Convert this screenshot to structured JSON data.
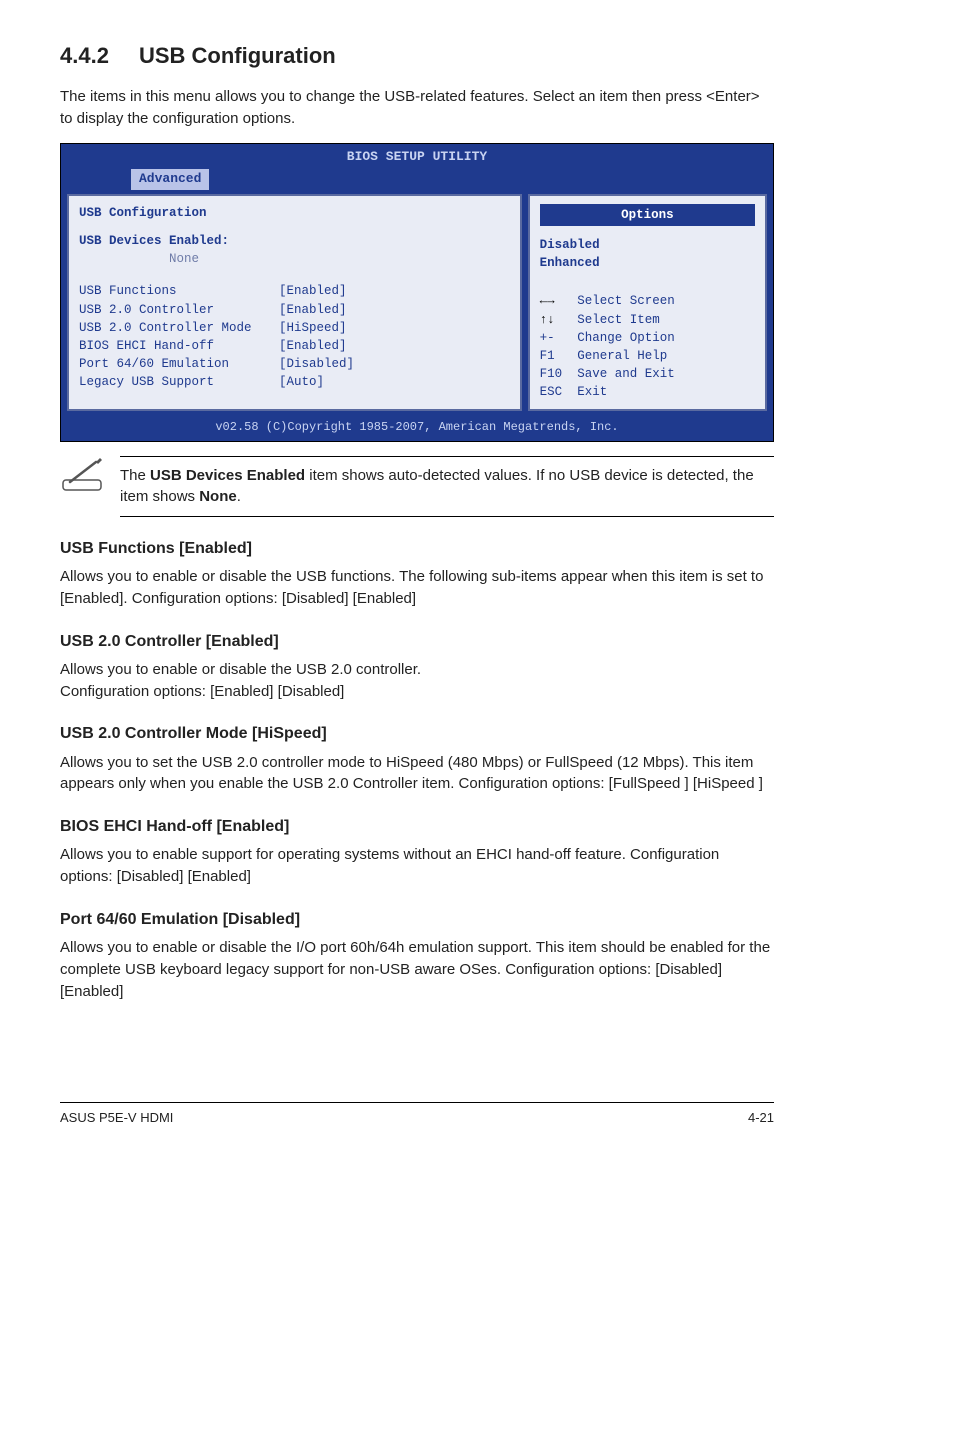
{
  "section": {
    "num": "4.4.2",
    "title": "USB Configuration"
  },
  "intro": "The items in this menu allows you to change the USB-related features. Select an item then press <Enter> to display the configuration options.",
  "bios": {
    "utility_title": "BIOS SETUP UTILITY",
    "tab": "Advanced",
    "left": {
      "heading": "USB Configuration",
      "devices_label": "USB Devices Enabled:",
      "devices_value": "None",
      "rows": [
        {
          "label": "USB Functions",
          "value": "[Enabled]"
        },
        {
          "label": "USB 2.0 Controller",
          "value": "[Enabled]"
        },
        {
          "label": "USB 2.0 Controller Mode",
          "value": "[HiSpeed]"
        },
        {
          "label": "BIOS EHCI Hand-off",
          "value": "[Enabled]"
        },
        {
          "label": "Port 64/60 Emulation",
          "value": "[Disabled]"
        },
        {
          "label": "Legacy USB Support",
          "value": "[Auto]"
        }
      ]
    },
    "right": {
      "options_title": "Options",
      "opt1": "Disabled",
      "opt2": "Enhanced",
      "help": [
        {
          "key": "←→",
          "txt": "Select Screen"
        },
        {
          "key": "↑↓",
          "txt": "Select Item"
        },
        {
          "key": "+-",
          "txt": "Change Option"
        },
        {
          "key": "F1",
          "txt": "General Help"
        },
        {
          "key": "F10",
          "txt": "Save and Exit"
        },
        {
          "key": "ESC",
          "txt": "Exit"
        }
      ]
    },
    "footer": "v02.58 (C)Copyright 1985-2007, American Megatrends, Inc."
  },
  "note": {
    "pre": "The ",
    "bold1": "USB Devices Enabled",
    "mid": " item shows auto-detected values. If no USB device is detected, the item shows ",
    "bold2": "None",
    "post": "."
  },
  "subs": {
    "s1": {
      "h": "USB Functions [Enabled]",
      "p": "Allows you to enable or disable the USB functions. The following sub-items appear when this item is set to [Enabled]. Configuration options: [Disabled] [Enabled]"
    },
    "s2": {
      "h": "USB 2.0 Controller [Enabled]",
      "p1": "Allows you to enable or disable the USB 2.0 controller.",
      "p2": "Configuration options: [Enabled] [Disabled]"
    },
    "s3": {
      "h": "USB 2.0 Controller Mode [HiSpeed]",
      "p": "Allows you to set the USB 2.0 controller mode to HiSpeed (480 Mbps) or FullSpeed (12 Mbps). This item appears only when you enable the USB 2.0 Controller item. Configuration options: [FullSpeed ] [HiSpeed ]"
    },
    "s4": {
      "h": "BIOS EHCI Hand-off [Enabled]",
      "p": "Allows you to enable support for operating systems without an EHCI hand-off feature. Configuration options: [Disabled] [Enabled]"
    },
    "s5": {
      "h": "Port 64/60 Emulation [Disabled]",
      "p": "Allows you to enable or disable the I/O port 60h/64h emulation support. This item should be enabled for the complete USB keyboard legacy support for non-USB aware OSes. Configuration options: [Disabled] [Enabled]"
    }
  },
  "pagefooter": {
    "left": "ASUS P5E-V HDMI",
    "right": "4-21"
  }
}
